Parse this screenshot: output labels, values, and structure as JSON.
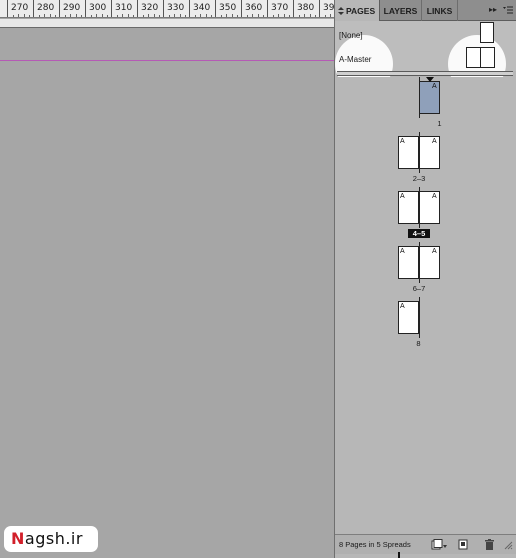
{
  "ruler": {
    "labels": [
      "270",
      "280",
      "290",
      "300",
      "310",
      "320",
      "330",
      "340",
      "350",
      "360",
      "370",
      "380",
      "39"
    ]
  },
  "panel": {
    "tabs": [
      {
        "label": "PAGES",
        "active": true
      },
      {
        "label": "LAYERS",
        "active": false
      },
      {
        "label": "LINKS",
        "active": false
      }
    ],
    "forward_glyph": "▸▸",
    "masters": {
      "none_label": "[None]",
      "a_master_label": "A-Master"
    },
    "spreads": [
      {
        "label": "1",
        "pages": [
          {
            "letter": "A",
            "selected": true
          }
        ],
        "selected": false
      },
      {
        "label": "2–3",
        "pages": [
          {
            "letter": "A"
          },
          {
            "letter": "A"
          }
        ],
        "selected": false
      },
      {
        "label": "4–5",
        "pages": [
          {
            "letter": "A"
          },
          {
            "letter": "A"
          }
        ],
        "selected": true
      },
      {
        "label": "6–7",
        "pages": [
          {
            "letter": "A"
          },
          {
            "letter": "A"
          }
        ],
        "selected": false
      },
      {
        "label": "8",
        "pages": [
          {
            "letter": "A"
          }
        ],
        "selected": false
      }
    ],
    "status": "8 Pages in 5 Spreads",
    "colors": {
      "selected_page_fill": "#8fa0ba",
      "guide_color": "#b55ab5",
      "watermark_accent": "#d21f2a"
    }
  },
  "watermark": {
    "first_letter": "N",
    "rest": "agsh.ir"
  }
}
